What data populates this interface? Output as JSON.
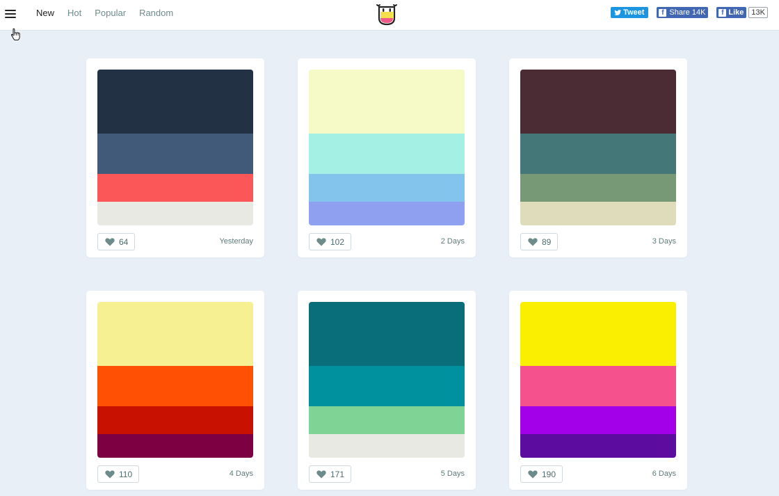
{
  "nav": {
    "items": [
      {
        "label": "New",
        "active": true
      },
      {
        "label": "Hot",
        "active": false
      },
      {
        "label": "Popular",
        "active": false
      },
      {
        "label": "Random",
        "active": false
      }
    ]
  },
  "social": {
    "tweet_label": "Tweet",
    "share_label": "Share 14K",
    "like_label": "Like",
    "like_count": "13K"
  },
  "palettes": [
    {
      "likes": "64",
      "date": "Yesterday",
      "colors": [
        "#223144",
        "#425a7a",
        "#fc5758",
        "#e9e9e4"
      ]
    },
    {
      "likes": "102",
      "date": "2 Days",
      "colors": [
        "#f5fac7",
        "#a5f0e4",
        "#83c4ec",
        "#8fa0f1"
      ]
    },
    {
      "likes": "89",
      "date": "3 Days",
      "colors": [
        "#4b2c34",
        "#447878",
        "#789975",
        "#dedcbb"
      ]
    },
    {
      "likes": "110",
      "date": "4 Days",
      "colors": [
        "#f6f092",
        "#ff5004",
        "#c81101",
        "#7c0042"
      ]
    },
    {
      "likes": "171",
      "date": "5 Days",
      "colors": [
        "#0a6d7a",
        "#00919f",
        "#7ed395",
        "#e9e9e4"
      ]
    },
    {
      "likes": "190",
      "date": "6 Days",
      "colors": [
        "#faef00",
        "#f5518c",
        "#a300e9",
        "#5c0d9f"
      ]
    }
  ]
}
